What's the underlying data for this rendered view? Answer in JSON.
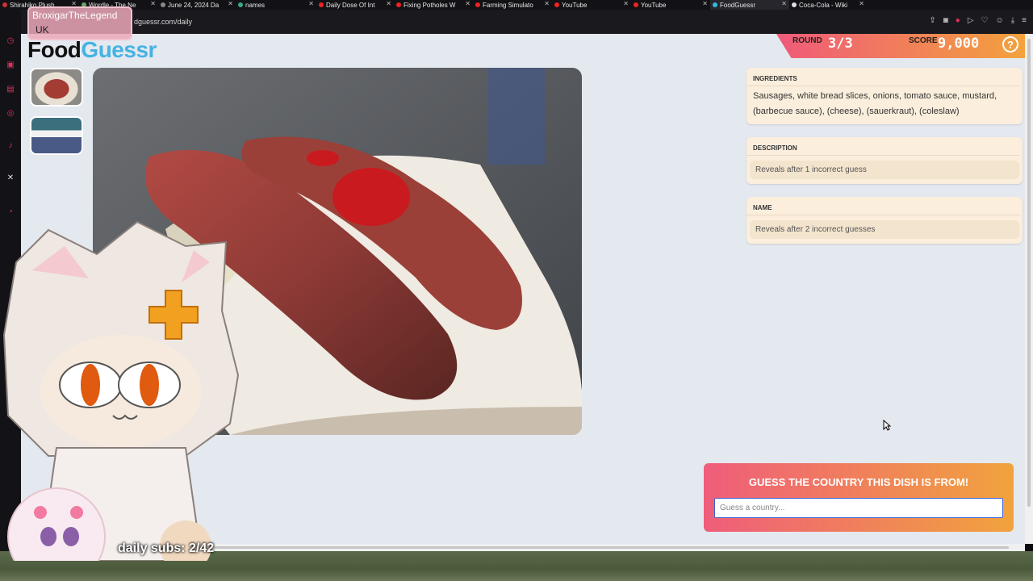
{
  "browser": {
    "tabs": [
      {
        "label": "Shirahiko Plush",
        "fav": "#c33"
      },
      {
        "label": "Wordle - The Ne",
        "fav": "#6a6"
      },
      {
        "label": "June 24, 2024 Da",
        "fav": "#888"
      },
      {
        "label": "names",
        "fav": "#3a8"
      },
      {
        "label": "Daily Dose Of Int",
        "fav": "#e22"
      },
      {
        "label": "Fixing Potholes W",
        "fav": "#e22"
      },
      {
        "label": "Farming Simulato",
        "fav": "#e22"
      },
      {
        "label": "YouTube",
        "fav": "#e22"
      },
      {
        "label": "YouTube",
        "fav": "#e22"
      },
      {
        "label": "FoodGuessr",
        "fav": "#3bd"
      },
      {
        "label": "Coca-Cola - Wiki",
        "fav": "#ddd"
      }
    ],
    "url": "dguessr.com/daily"
  },
  "header": {
    "logo_food": "Food",
    "logo_guessr": "Guessr",
    "round_label": "ROUND",
    "round_value": "3/3",
    "score_label": "SCORE",
    "score_value": "9,000",
    "help": "?"
  },
  "clues": {
    "ingredients_title": "INGREDIENTS",
    "ingredients_text": "Sausages, white bread slices, onions, tomato sauce, mustard, (barbecue sauce), (cheese), (sauerkraut), (coleslaw)",
    "description_title": "DESCRIPTION",
    "description_locked": "Reveals after 1 incorrect guess",
    "name_title": "NAME",
    "name_locked": "Reveals after 2 incorrect guesses"
  },
  "guess": {
    "prompt": "GUESS THE COUNTRY THIS DISH IS FROM!",
    "placeholder": "Guess a country..."
  },
  "overlay": {
    "username": "BroxigarTheLegend",
    "chat": "UK",
    "subs": "daily subs: 2/42"
  },
  "colors": {
    "accent_pink": "#ef5a7a",
    "accent_orange": "#f3a23c",
    "logo_blue": "#45b3e3",
    "card_bg": "#fbeedd"
  }
}
